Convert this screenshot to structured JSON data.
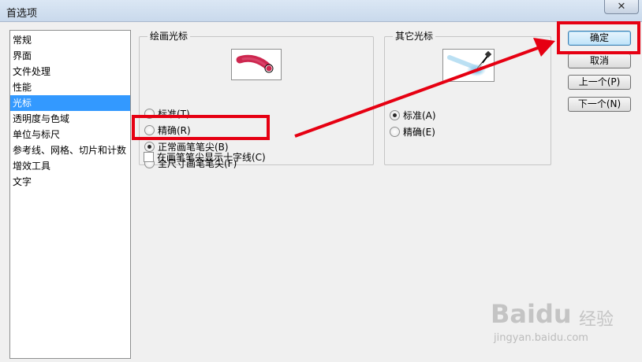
{
  "window": {
    "title": "首选项",
    "close_glyph": "✕"
  },
  "categories": [
    {
      "label": "常规",
      "selected": false
    },
    {
      "label": "界面",
      "selected": false
    },
    {
      "label": "文件处理",
      "selected": false
    },
    {
      "label": "性能",
      "selected": false
    },
    {
      "label": "光标",
      "selected": true
    },
    {
      "label": "透明度与色域",
      "selected": false
    },
    {
      "label": "单位与标尺",
      "selected": false
    },
    {
      "label": "参考线、网格、切片和计数",
      "selected": false
    },
    {
      "label": "增效工具",
      "selected": false
    },
    {
      "label": "文字",
      "selected": false
    }
  ],
  "painting_cursors": {
    "label": "绘画光标",
    "options": [
      {
        "label": "标准(T)",
        "checked": false
      },
      {
        "label": "精确(R)",
        "checked": false
      },
      {
        "label": "正常画笔笔尖(B)",
        "checked": true
      },
      {
        "label": "全尺寸画笔笔尖(F)",
        "checked": false
      }
    ],
    "crosshair_checkbox": {
      "label": "在画笔笔尖显示十字线(C)",
      "checked": false
    }
  },
  "other_cursors": {
    "label": "其它光标",
    "options": [
      {
        "label": "标准(A)",
        "checked": true
      },
      {
        "label": "精确(E)",
        "checked": false
      }
    ]
  },
  "buttons": {
    "ok": "确定",
    "cancel": "取消",
    "prev": "上一个(P)",
    "next": "下一个(N)"
  },
  "watermark": {
    "logo": "Bai",
    "logo_suffix": "du",
    "text": "经验",
    "url": "jingyan.baidu.com"
  },
  "colors": {
    "selection": "#3399ff",
    "annotation": "#e60012",
    "brush": "#c8103c",
    "eyedropper_glow": "#3aa8e0"
  },
  "icons": {
    "close": "close-icon",
    "brush_preview": "brush-stroke-icon",
    "eyedropper_preview": "eyedropper-icon"
  }
}
